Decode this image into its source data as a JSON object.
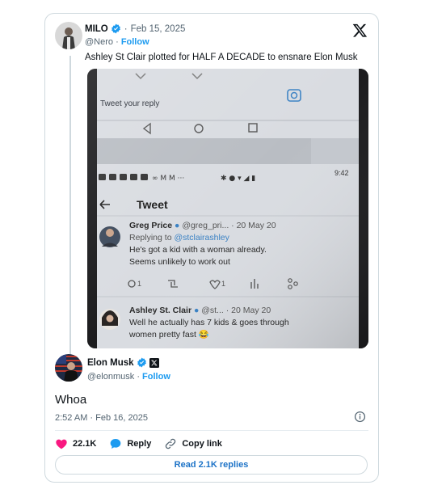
{
  "quoted_tweet": {
    "author_name": "MILO",
    "handle": "@Nero",
    "separator": "·",
    "date": "Feb 15, 2025",
    "follow_label": "Follow",
    "text": "Ashley St Clair plotted for HALF A DECADE to ensnare Elon Musk"
  },
  "media": {
    "reply_placeholder": "Tweet your reply",
    "status_time": "9:42",
    "header_title": "Tweet",
    "replies": [
      {
        "name": "Greg Price",
        "handle": "@greg_pri...",
        "date": "· 20 May 20",
        "replying_prefix": "Replying to",
        "replying_handle": "@stclairashley",
        "text_line1": "He's got a kid with a woman already.",
        "text_line2": "Seems unlikely to work out",
        "reply_count": "1",
        "like_count": "1"
      },
      {
        "name": "Ashley St. Clair",
        "handle": "@st...",
        "date": "· 20 May 20",
        "text_line1": "Well he actually has 7 kids & goes through",
        "text_line2": "women pretty fast 😂"
      }
    ]
  },
  "main_tweet": {
    "author_name": "Elon Musk",
    "handle": "@elonmusk",
    "separator": "·",
    "follow_label": "Follow",
    "text": "Whoa",
    "timestamp": "2:52 AM · Feb 16, 2025"
  },
  "actions": {
    "like_count": "22.1K",
    "reply_label": "Reply",
    "copy_link_label": "Copy link"
  },
  "read_replies_label": "Read 2.1K replies",
  "colors": {
    "accent": "#1d9bf0",
    "like": "#f91880",
    "text": "#0f1419",
    "muted": "#536471"
  }
}
